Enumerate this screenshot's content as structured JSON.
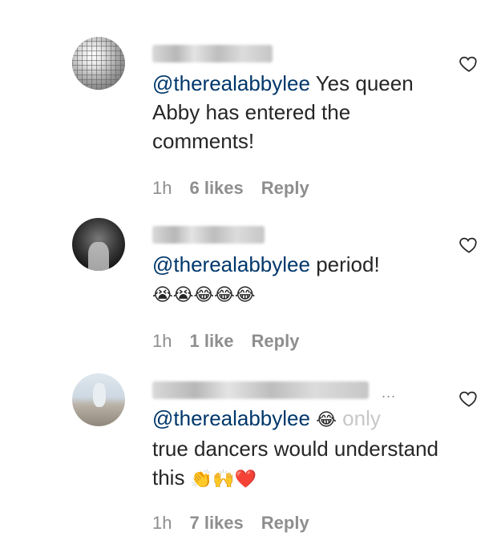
{
  "comments": [
    {
      "mention": "@therealabbylee",
      "text": " Yes queen Abby has entered the comments!",
      "time": "1h",
      "likes": "6 likes",
      "reply": "Reply",
      "avatar": "disco-ball-avatar"
    },
    {
      "mention": "@therealabbylee",
      "text": " period!",
      "emoji": "😭😭😂😂😂",
      "time": "1h",
      "likes": "1 like",
      "reply": "Reply",
      "avatar": "portrait-avatar"
    },
    {
      "mention": "@therealabbylee",
      "emoji_a": "😂",
      "faded": " only",
      "text": "true dancers would understand this",
      "emoji_b": "👏🙌❤️",
      "time": "1h",
      "likes": "7 likes",
      "reply": "Reply",
      "more": "...",
      "avatar": "beach-avatar"
    }
  ],
  "icons": {
    "like": "heart-outline-icon"
  },
  "colors": {
    "mention": "#00376b",
    "meta": "#8e8e8e",
    "text": "#262626"
  }
}
